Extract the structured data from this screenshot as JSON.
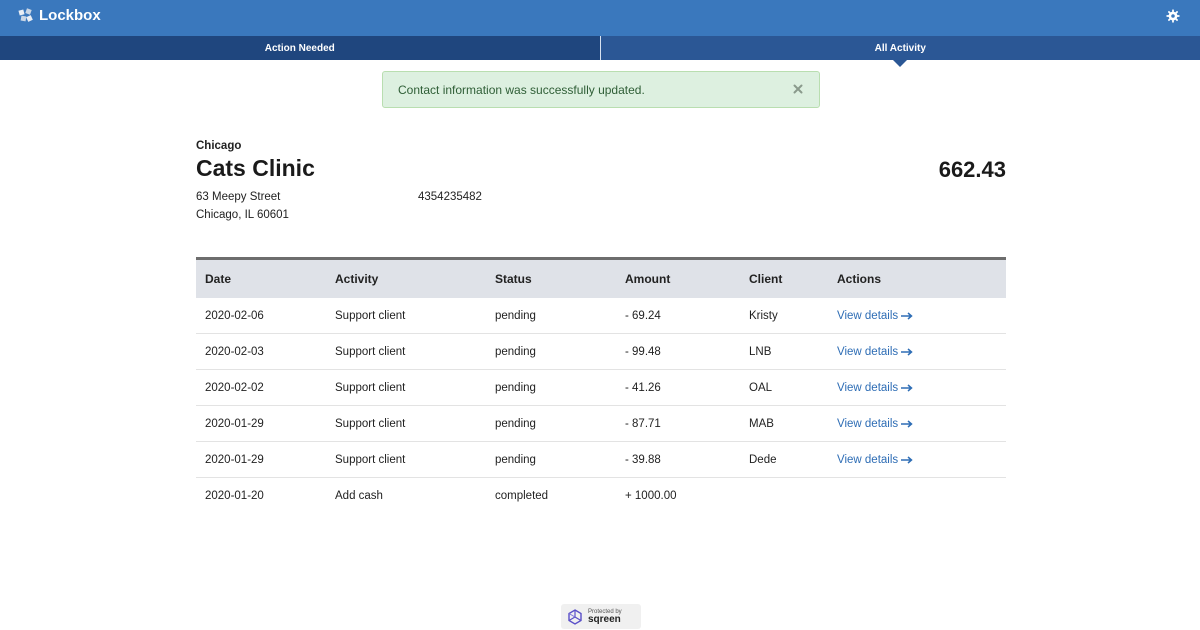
{
  "app": {
    "title": "Lockbox"
  },
  "tabs": [
    {
      "label": "Action Needed"
    },
    {
      "label": "All Activity"
    }
  ],
  "alert": {
    "message": "Contact information was successfully updated."
  },
  "account": {
    "city": "Chicago",
    "name": "Cats Clinic",
    "street": "63 Meepy Street",
    "city_state": "Chicago, IL 60601",
    "phone": "4354235482",
    "balance": "662.43"
  },
  "table": {
    "headers": [
      "Date",
      "Activity",
      "Status",
      "Amount",
      "Client",
      "Actions"
    ],
    "rows": [
      {
        "date": "2020-02-06",
        "activity": "Support client",
        "status": "pending",
        "amount": "- 69.24",
        "client": "Kristy",
        "action": "View details"
      },
      {
        "date": "2020-02-03",
        "activity": "Support client",
        "status": "pending",
        "amount": "- 99.48",
        "client": "LNB",
        "action": "View details"
      },
      {
        "date": "2020-02-02",
        "activity": "Support client",
        "status": "pending",
        "amount": "- 41.26",
        "client": "OAL",
        "action": "View details"
      },
      {
        "date": "2020-01-29",
        "activity": "Support client",
        "status": "pending",
        "amount": "- 87.71",
        "client": "MAB",
        "action": "View details"
      },
      {
        "date": "2020-01-29",
        "activity": "Support client",
        "status": "pending",
        "amount": "- 39.88",
        "client": "Dede",
        "action": "View details"
      },
      {
        "date": "2020-01-20",
        "activity": "Add cash",
        "status": "completed",
        "amount": "+ 1000.00",
        "client": "",
        "action": ""
      }
    ]
  },
  "footer": {
    "protected_by": "Protected by",
    "brand": "sqreen"
  },
  "icons": {
    "brand": "lockbox-logo-icon",
    "settings": "gear-icon",
    "close": "close-icon",
    "link_arrow": "arrow-right-icon",
    "footer": "sqreen-logo-icon"
  },
  "colors": {
    "header": "#3a78bd",
    "tab_active": "#1f467e",
    "tab_inactive": "#2b5795",
    "alert_bg": "#ddf0e0",
    "link": "#2e6db5"
  }
}
